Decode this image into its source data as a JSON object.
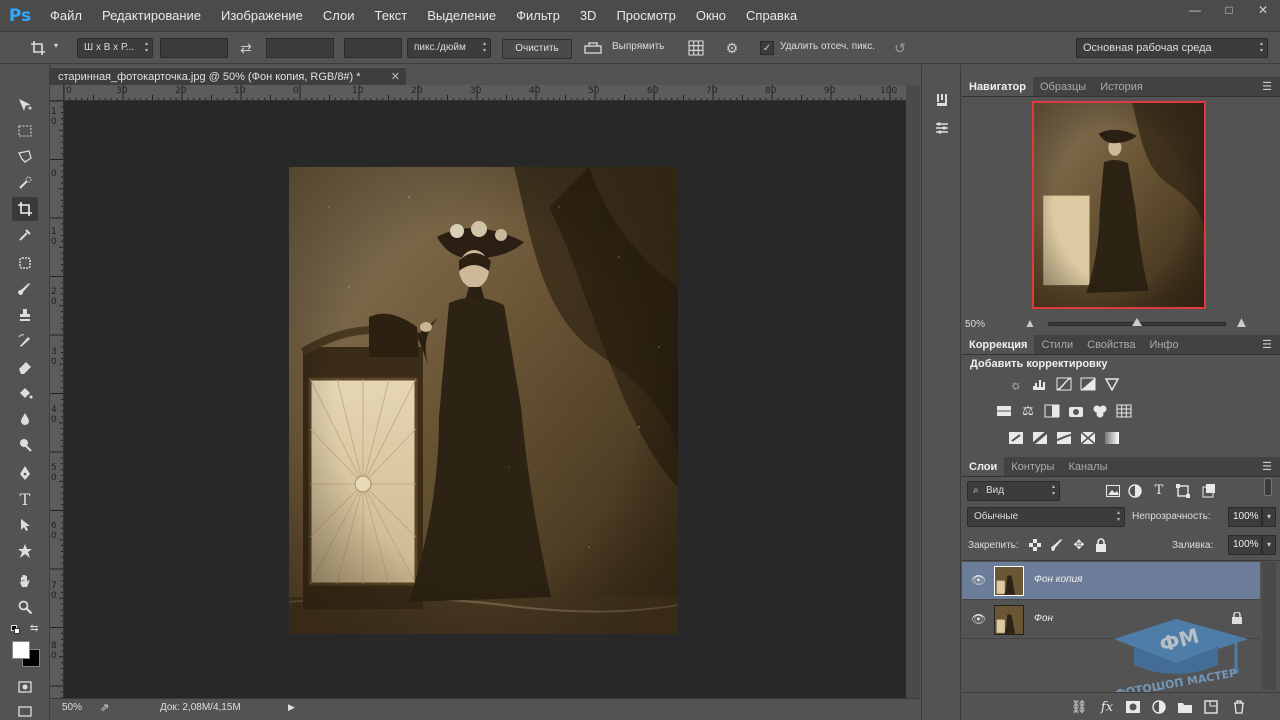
{
  "menu": {
    "logo": "Ps",
    "items": [
      "Файл",
      "Редактирование",
      "Изображение",
      "Слои",
      "Текст",
      "Выделение",
      "Фильтр",
      "3D",
      "Просмотр",
      "Окно",
      "Справка"
    ]
  },
  "window_controls": {
    "minimize": "—",
    "maximize": "□",
    "close": "✕"
  },
  "options": {
    "ratio_label": "Ш x В x Р...",
    "units_label": "пикс./дюйм",
    "clear_label": "Очистить",
    "straighten_label": "Выпрямить",
    "delete_cropped_label": "Удалить отсеч. пикс.",
    "workspace_label": "Основная рабочая среда"
  },
  "document": {
    "tab_title": "старинная_фотокарточка.jpg @ 50% (Фон копия, RGB/8#) *",
    "close": "✕"
  },
  "ruler_top_labels": [
    "0",
    "30",
    "20",
    "10",
    "0",
    "10",
    "20",
    "30",
    "40",
    "50",
    "60",
    "70",
    "80",
    "90",
    "100"
  ],
  "ruler_left_labels": [
    "1",
    "0",
    "0",
    "1",
    "0",
    "2",
    "0",
    "3",
    "0",
    "4",
    "0",
    "5",
    "0",
    "6",
    "0",
    "7",
    "0",
    "8",
    "0"
  ],
  "status": {
    "zoom": "50%",
    "doc_info": "Док: 2,08M/4,15M"
  },
  "navigator": {
    "tabs": [
      "Навигатор",
      "Образцы",
      "История"
    ],
    "zoom": "50%",
    "zoom_level": 0.5
  },
  "adjustments": {
    "tabs": [
      "Коррекция",
      "Стили",
      "Свойства",
      "Инфо"
    ],
    "heading": "Добавить корректировку",
    "icons": [
      "brightness-contrast-icon",
      "levels-icon",
      "curves-icon",
      "exposure-icon",
      "vibrance-icon",
      "hue-saturation-icon",
      "color-balance-icon",
      "black-white-icon",
      "photo-filter-icon",
      "channel-mixer-icon",
      "color-lookup-icon",
      "invert-icon",
      "posterize-icon",
      "threshold-icon",
      "selective-color-icon",
      "gradient-map-icon"
    ]
  },
  "layers": {
    "tabs": [
      "Слои",
      "Контуры",
      "Каналы"
    ],
    "filter_label": "Вид",
    "blend_mode": "Обычные",
    "opacity_label": "Непрозрачность:",
    "opacity_value": "100%",
    "lock_label": "Закрепить:",
    "fill_label": "Заливка:",
    "fill_value": "100%",
    "items": [
      {
        "name": "Фон копия",
        "selected": true,
        "locked": false
      },
      {
        "name": "Фон",
        "selected": false,
        "locked": true
      }
    ]
  },
  "watermark": {
    "logo_text": "ФМ",
    "caption": "ФОТОШОП МАСТЕР"
  },
  "colors": {
    "accent": "#31a8ff",
    "selected_layer": "#6b7d99",
    "navigator_frame": "#e0393e",
    "photo_sepia": "#5e4a2e"
  }
}
